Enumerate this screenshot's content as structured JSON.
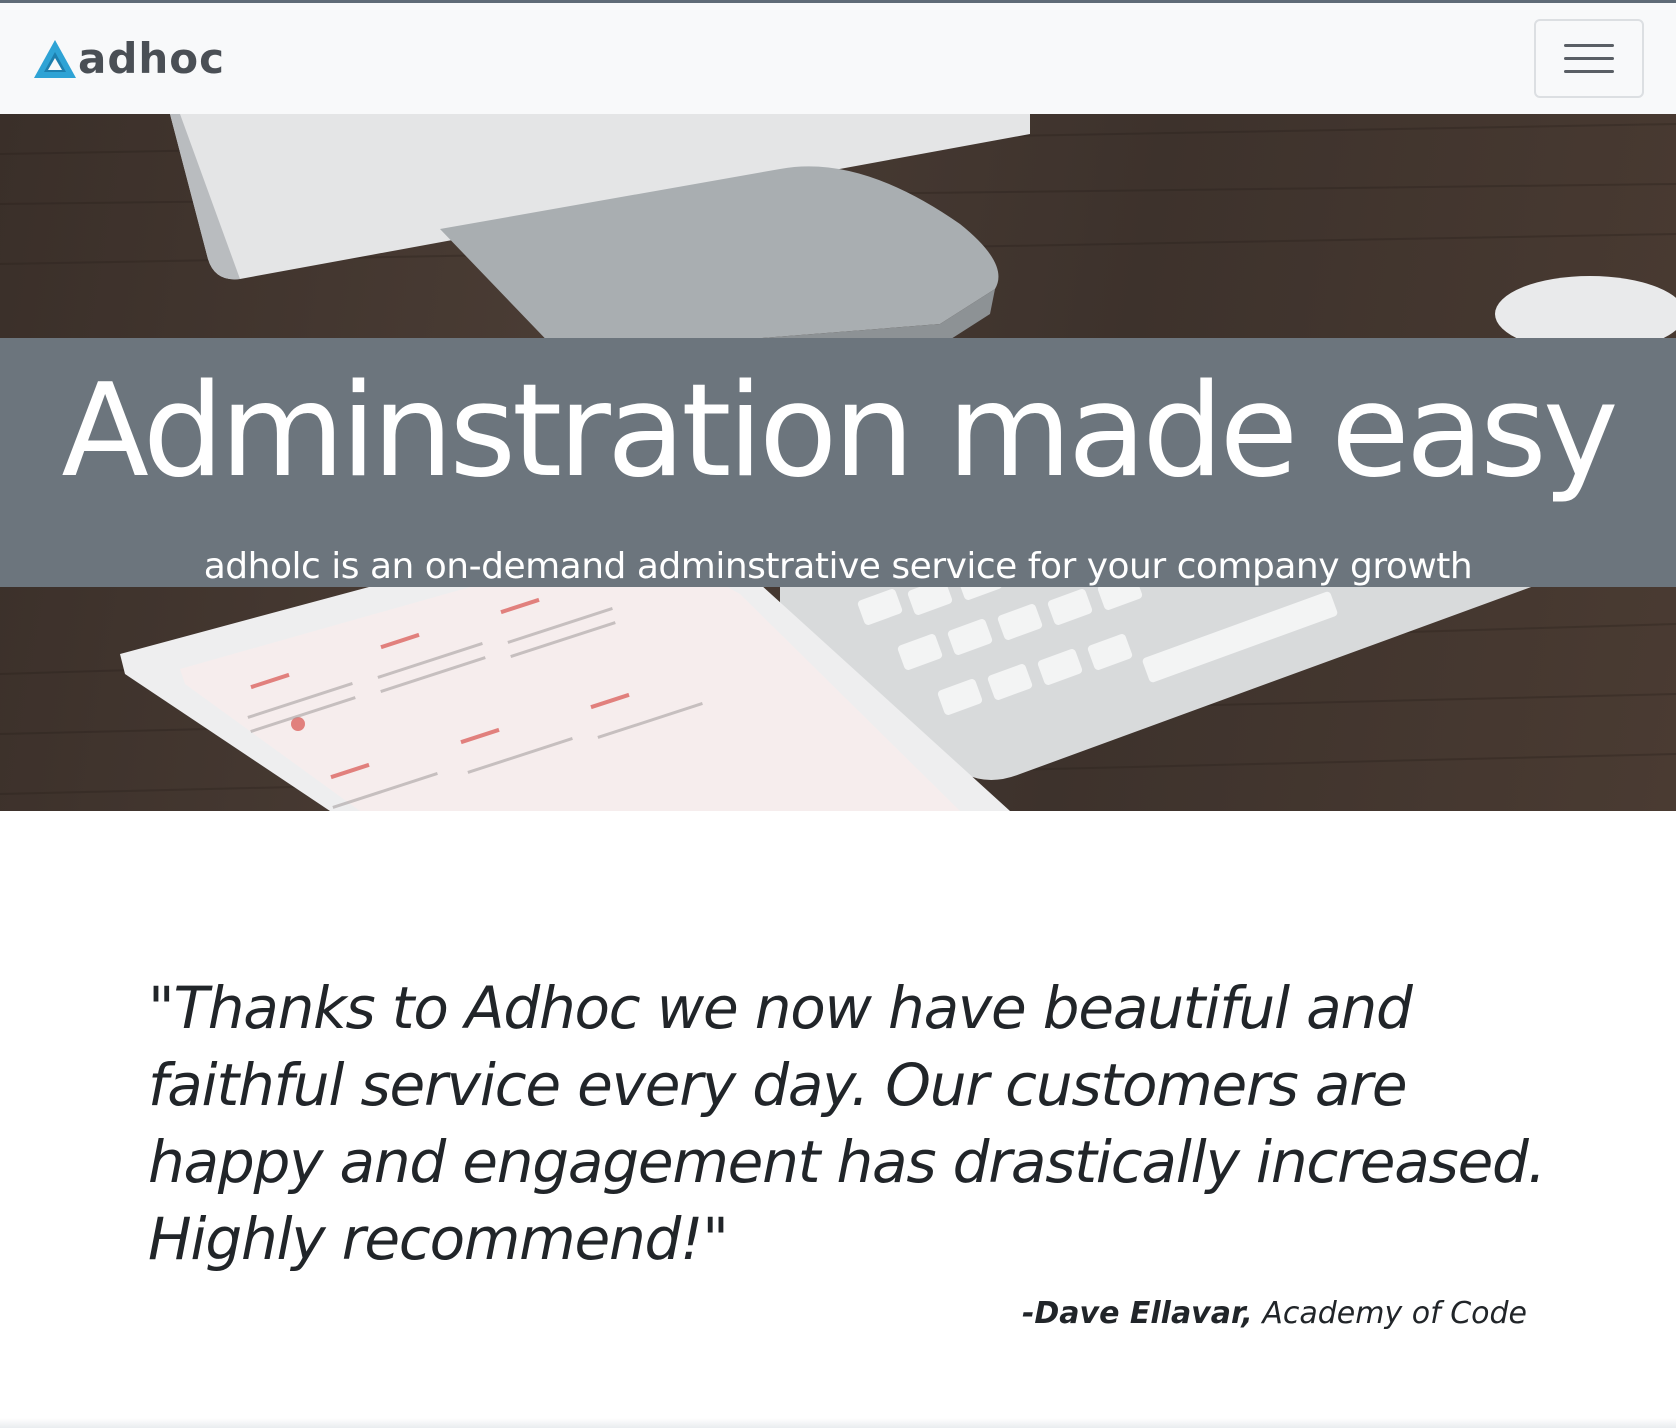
{
  "navbar": {
    "brand_name": "adhoc",
    "logo_icon": "triangle-logo-icon",
    "toggler_icon": "hamburger-menu-icon",
    "background_color": "#f8f9fa"
  },
  "hero": {
    "title": "Adminstration made easy",
    "subtitle": "adholc is an on-demand adminstrative service for your company growth",
    "band_color": "#6c757d"
  },
  "testimonial": {
    "quote": "\"Thanks to Adhoc we now have beautiful and faithful service every day. Our customers are happy and engagement has drastically increased. Highly recommend!\"",
    "author": "-Dave Ellavar,",
    "company": "Academy of Code"
  },
  "colors": {
    "brand_logo_blue": "#2ea3d5",
    "text_dark": "#212529"
  }
}
